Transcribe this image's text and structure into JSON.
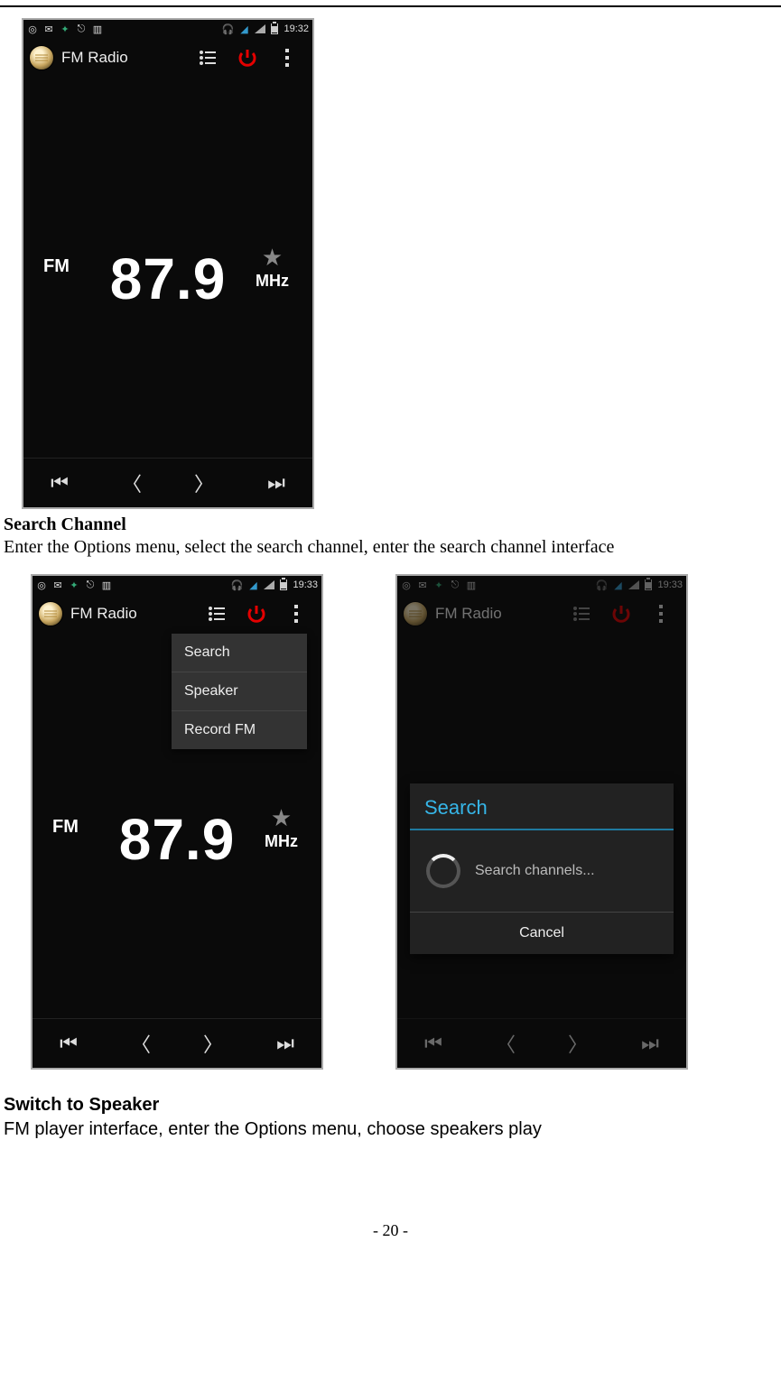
{
  "doc": {
    "heading1": "Search Channel",
    "para1": "Enter the Options menu, select the search channel, enter the search channel interface",
    "heading2": "Switch to Speaker",
    "para2": "FM player interface, enter the Options menu, choose speakers play",
    "page_number": "- 20 -"
  },
  "phone_common": {
    "app_title": "FM Radio",
    "fm_label": "FM",
    "frequency": "87.9",
    "unit": "MHz"
  },
  "statusbar": {
    "time1": "19:32",
    "time2": "19:33"
  },
  "menu": {
    "item1": "Search",
    "item2": "Speaker",
    "item3": "Record FM"
  },
  "dialog": {
    "title": "Search",
    "message": "Search channels...",
    "cancel": "Cancel"
  }
}
